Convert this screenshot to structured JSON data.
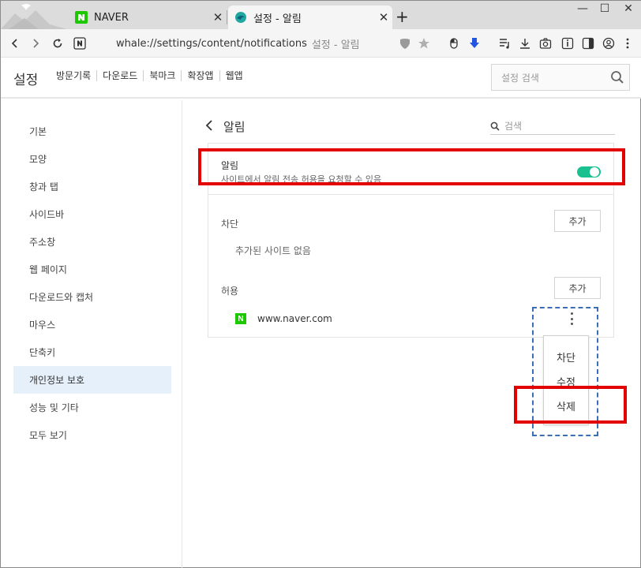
{
  "tabs": [
    {
      "title": "NAVER",
      "favicon": "naver-icon",
      "active": false
    },
    {
      "title": "설정 - 알림",
      "favicon": "whale-icon",
      "active": true
    }
  ],
  "toolbar": {
    "url": "whale://settings/content/notifications",
    "page_title": "설정 - 알림"
  },
  "settings_header": {
    "title": "설정",
    "nav": [
      "방문기록",
      "다운로드",
      "북마크",
      "확장앱",
      "웹앱"
    ],
    "search_placeholder": "설정 검색"
  },
  "sidebar": {
    "items": [
      {
        "label": "기본"
      },
      {
        "label": "모양"
      },
      {
        "label": "창과 탭"
      },
      {
        "label": "사이드바"
      },
      {
        "label": "주소창"
      },
      {
        "label": "웹 페이지"
      },
      {
        "label": "다운로드와 캡처"
      },
      {
        "label": "마우스"
      },
      {
        "label": "단축키"
      },
      {
        "label": "개인정보 보호",
        "active": true
      },
      {
        "label": "성능 및 기타"
      },
      {
        "label": "모두 보기"
      }
    ]
  },
  "main": {
    "title": "알림",
    "search_placeholder": "검색",
    "notifications": {
      "title": "알림",
      "description": "사이트에서 알림 전송 허용을 요청할 수 있음",
      "enabled": true
    },
    "block": {
      "label": "차단",
      "add_label": "추가",
      "empty_text": "추가된 사이트 없음"
    },
    "allow": {
      "label": "허용",
      "add_label": "추가",
      "sites": [
        {
          "url": "www.naver.com",
          "favicon": "naver-icon"
        }
      ]
    },
    "context_menu": [
      "차단",
      "수정",
      "삭제"
    ]
  },
  "colors": {
    "toggle_on": "#19c090",
    "annotation_red": "#e20000",
    "annotation_blue": "#3a6fb8",
    "sidebar_active": "#e6f0fa"
  }
}
